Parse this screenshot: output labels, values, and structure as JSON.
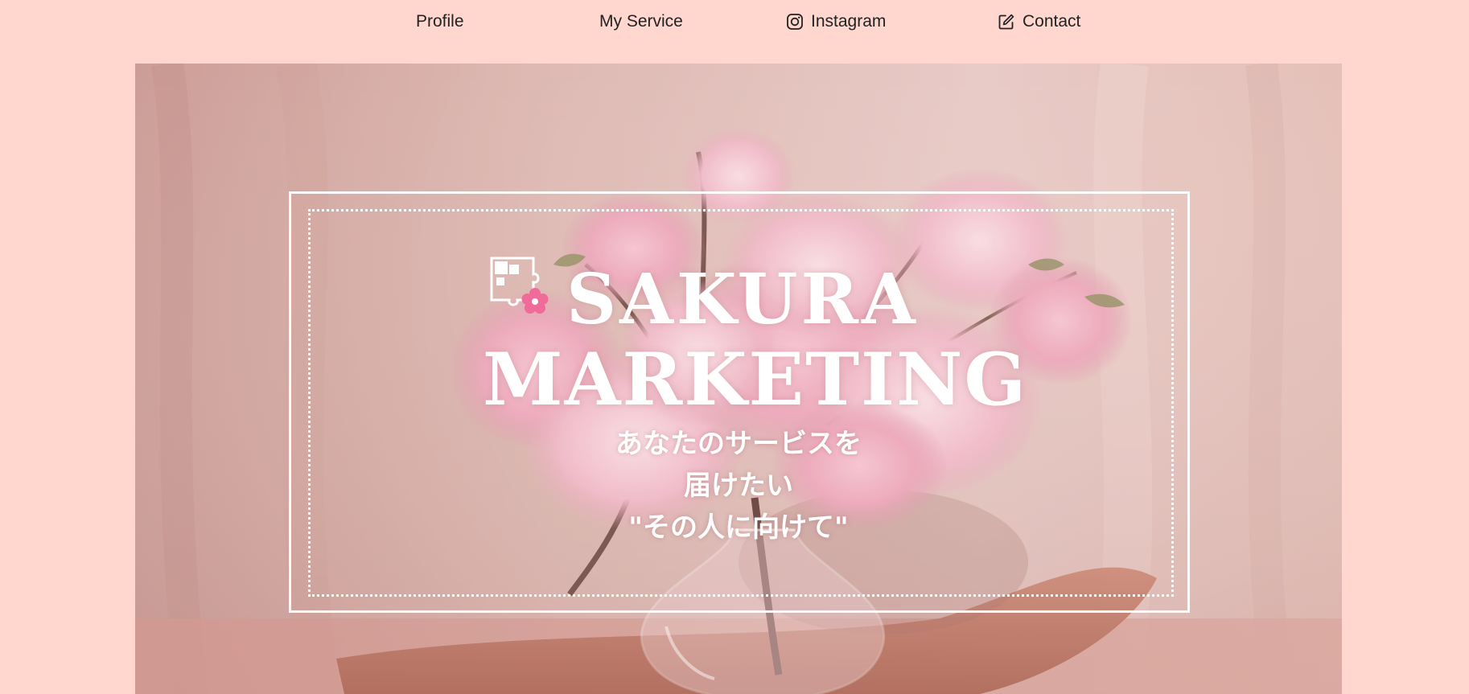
{
  "nav": {
    "items": [
      {
        "label": "Profile",
        "icon": ""
      },
      {
        "label": "My Service",
        "icon": ""
      },
      {
        "label": "Instagram",
        "icon": "instagram-icon"
      },
      {
        "label": "Contact",
        "icon": "edit-icon"
      }
    ]
  },
  "hero": {
    "brand_line1": "SAKURA",
    "brand_line2": "MARKETING",
    "tagline": [
      "あなたのサービスを",
      "届けたい",
      "\"その人に向けて\""
    ],
    "logo_icon": "puzzle-sakura-logo",
    "image": "cherry-blossom-vase-photo"
  },
  "colors": {
    "page_background": "#FFD7CF",
    "nav_text": "#222222",
    "title_text": "#FFFFFF",
    "sakura_accent": "#F06A9A"
  }
}
